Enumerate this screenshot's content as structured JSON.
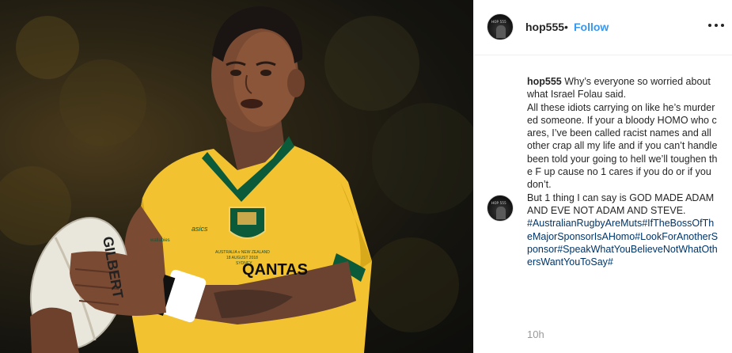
{
  "post": {
    "username": "hop555",
    "dot": "•",
    "follow_label": "Follow",
    "more_icon": "more-options-icon",
    "caption_text": " Why’s everyone so worried about what Israel Folau said.\nAll these idiots carrying on like he’s murdered someone. If your a bloody HOMO who cares, I’ve been called racist names and all other crap all my life and if you can’t handle been told your going to hell we’ll toughen the F up cause no 1 cares if you do or if you don’t.\nBut 1 thing I can say is GOD MADE ADAM AND EVE NOT ADAM AND STEVE.\n",
    "caption_tags": "#AustralianRugbyAreMuts#IfTheBossOfTheMajorSponsorIsAHomo#LookForAnotherSponsor#SpeakWhatYouBelieveNotWhatOthersWantYouToSay#",
    "timestamp": "10h",
    "avatar_text": "HOP 555"
  },
  "photo": {
    "jersey_sponsor": "QANTAS",
    "ball_brand": "GILBERT",
    "jersey_badge_text": "AUSTRALIA v NEW ZEALAND",
    "jersey_badge_sub": "18 AUGUST 2018",
    "jersey_badge_city": "SYDNEY",
    "jersey_maker": "asics",
    "jersey_wallabies": "wallabies"
  },
  "colors": {
    "link": "#3897f0",
    "hashtag": "#003569",
    "jersey_gold": "#f2c230",
    "jersey_green": "#0b5a3a"
  }
}
